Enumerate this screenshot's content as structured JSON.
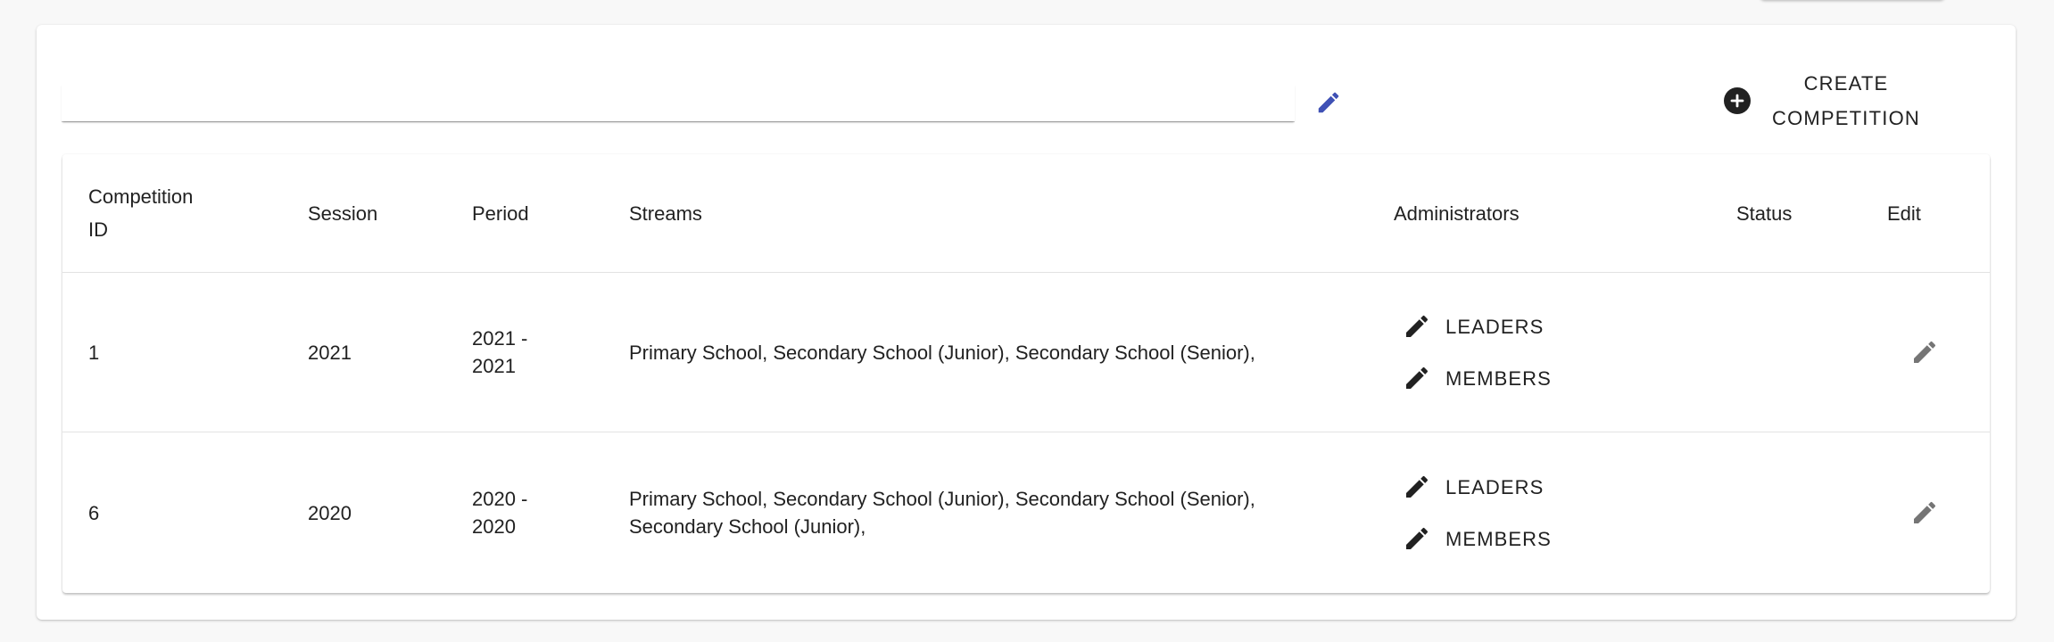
{
  "toolbar": {
    "search_value": "",
    "create_label": "CREATE COMPETITION"
  },
  "table": {
    "headers": {
      "id": "Competition ID",
      "session": "Session",
      "period": "Period",
      "streams": "Streams",
      "administrators": "Administrators",
      "status": "Status",
      "edit": "Edit"
    },
    "rows": [
      {
        "id": "1",
        "session": "2021",
        "period": "2021 - 2021",
        "streams": "Primary School, Secondary School (Junior), Secondary School (Senior),",
        "leaders_label": "LEADERS",
        "members_label": "MEMBERS",
        "status": ""
      },
      {
        "id": "6",
        "session": "2020",
        "period": "2020 - 2020",
        "streams": "Primary School, Secondary School (Junior), Secondary School (Senior), Secondary School (Junior),",
        "leaders_label": "LEADERS",
        "members_label": "MEMBERS",
        "status": ""
      }
    ]
  },
  "colors": {
    "accent_edit_icon": "#3f51b5",
    "row_edit_icon": "#757575",
    "text": "#212121"
  },
  "icons": {
    "search_edit": "pencil-icon",
    "create": "plus-circle-icon",
    "admin": "pencil-icon",
    "row_edit": "pencil-icon"
  }
}
